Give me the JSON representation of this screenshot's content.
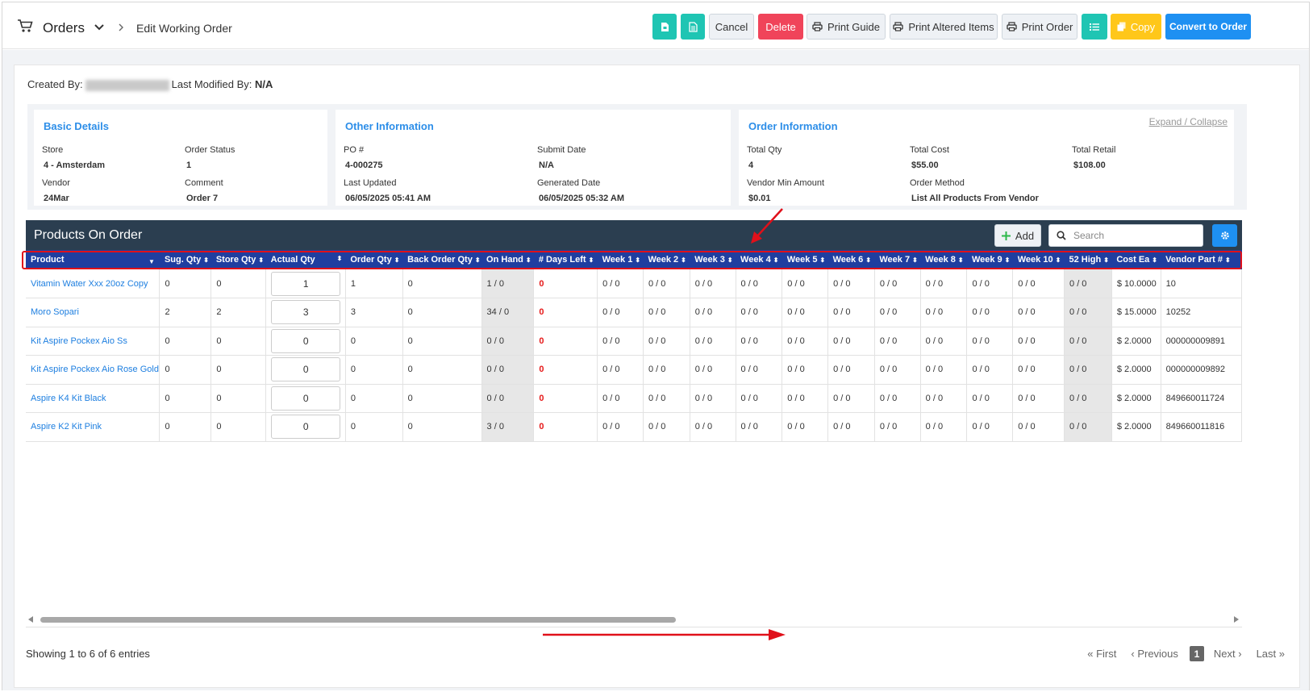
{
  "header": {
    "title": "Orders",
    "breadcrumb": "Edit Working Order",
    "buttons": {
      "cancel": "Cancel",
      "delete": "Delete",
      "print_guide": "Print Guide",
      "print_altered": "Print Altered Items",
      "print_order": "Print Order",
      "copy": "Copy",
      "convert": "Convert to Order"
    }
  },
  "meta": {
    "created_by_label": "Created By:",
    "last_modified_label": "Last Modified By:",
    "last_modified_value": "N/A"
  },
  "basic_details": {
    "title": "Basic Details",
    "store_label": "Store",
    "store_value": "4 - Amsterdam",
    "status_label": "Order Status",
    "status_value": "1",
    "vendor_label": "Vendor",
    "vendor_value": "24Mar",
    "comment_label": "Comment",
    "comment_value": "Order 7"
  },
  "other_info": {
    "title": "Other Information",
    "po_label": "PO #",
    "po_value": "4-000275",
    "submit_label": "Submit Date",
    "submit_value": "N/A",
    "updated_label": "Last Updated",
    "updated_value": "06/05/2025 05:41 AM",
    "generated_label": "Generated Date",
    "generated_value": "06/05/2025 05:32 AM"
  },
  "order_info": {
    "title": "Order Information",
    "expand_label": "Expand / Collapse",
    "qty_label": "Total Qty",
    "qty_value": "4",
    "cost_label": "Total Cost",
    "cost_value": "$55.00",
    "retail_label": "Total Retail",
    "retail_value": "$108.00",
    "min_label": "Vendor Min Amount",
    "min_value": "$0.01",
    "method_label": "Order Method",
    "method_value": "List All Products From Vendor"
  },
  "products": {
    "title": "Products On Order",
    "add_label": "Add",
    "search_placeholder": "Search",
    "columns": [
      "Product",
      "Sug. Qty",
      "Store Qty",
      "Actual Qty",
      "Order Qty",
      "Back Order Qty",
      "On Hand",
      "# Days Left",
      "Week 1",
      "Week 2",
      "Week 3",
      "Week 4",
      "Week 5",
      "Week 6",
      "Week 7",
      "Week 8",
      "Week 9",
      "Week 10",
      "52 High",
      "Cost Ea",
      "Vendor Part #"
    ],
    "rows": [
      {
        "product": "Vitamin Water Xxx 20oz Copy",
        "sug": "0",
        "store": "0",
        "actual": "1",
        "order": "1",
        "back": "0",
        "onhand": "1 / 0",
        "days": "0",
        "weeks": [
          "0 / 0",
          "0 / 0",
          "0 / 0",
          "0 / 0",
          "0 / 0",
          "0 / 0",
          "0 / 0",
          "0 / 0",
          "0 / 0",
          "0 / 0"
        ],
        "high": "0 / 0",
        "cost": "$ 10.0000",
        "part": "10"
      },
      {
        "product": "Moro Sopari",
        "sug": "2",
        "store": "2",
        "actual": "3",
        "order": "3",
        "back": "0",
        "onhand": "34 / 0",
        "days": "0",
        "weeks": [
          "0 / 0",
          "0 / 0",
          "0 / 0",
          "0 / 0",
          "0 / 0",
          "0 / 0",
          "0 / 0",
          "0 / 0",
          "0 / 0",
          "0 / 0"
        ],
        "high": "0 / 0",
        "cost": "$ 15.0000",
        "part": "10252"
      },
      {
        "product": "Kit Aspire Pockex Aio Ss",
        "sug": "0",
        "store": "0",
        "actual": "0",
        "order": "0",
        "back": "0",
        "onhand": "0 / 0",
        "days": "0",
        "weeks": [
          "0 / 0",
          "0 / 0",
          "0 / 0",
          "0 / 0",
          "0 / 0",
          "0 / 0",
          "0 / 0",
          "0 / 0",
          "0 / 0",
          "0 / 0"
        ],
        "high": "0 / 0",
        "cost": "$ 2.0000",
        "part": "000000009891"
      },
      {
        "product": "Kit Aspire Pockex Aio Rose Gold",
        "sug": "0",
        "store": "0",
        "actual": "0",
        "order": "0",
        "back": "0",
        "onhand": "0 / 0",
        "days": "0",
        "weeks": [
          "0 / 0",
          "0 / 0",
          "0 / 0",
          "0 / 0",
          "0 / 0",
          "0 / 0",
          "0 / 0",
          "0 / 0",
          "0 / 0",
          "0 / 0"
        ],
        "high": "0 / 0",
        "cost": "$ 2.0000",
        "part": "000000009892"
      },
      {
        "product": "Aspire K4 Kit Black",
        "sug": "0",
        "store": "0",
        "actual": "0",
        "order": "0",
        "back": "0",
        "onhand": "0 / 0",
        "days": "0",
        "weeks": [
          "0 / 0",
          "0 / 0",
          "0 / 0",
          "0 / 0",
          "0 / 0",
          "0 / 0",
          "0 / 0",
          "0 / 0",
          "0 / 0",
          "0 / 0"
        ],
        "high": "0 / 0",
        "cost": "$ 2.0000",
        "part": "849660011724"
      },
      {
        "product": "Aspire K2 Kit Pink",
        "sug": "0",
        "store": "0",
        "actual": "0",
        "order": "0",
        "back": "0",
        "onhand": "3 / 0",
        "days": "0",
        "weeks": [
          "0 / 0",
          "0 / 0",
          "0 / 0",
          "0 / 0",
          "0 / 0",
          "0 / 0",
          "0 / 0",
          "0 / 0",
          "0 / 0",
          "0 / 0"
        ],
        "high": "0 / 0",
        "cost": "$ 2.0000",
        "part": "849660011816"
      }
    ]
  },
  "footer": {
    "showing": "Showing 1 to 6 of 6 entries",
    "first": "« First",
    "previous": "‹ Previous",
    "current_page": "1",
    "next": "Next ›",
    "last": "Last »"
  },
  "colors": {
    "teal": "#1fc5b3",
    "red": "#f0445a",
    "yellow": "#ffc71a",
    "blue": "#1e90f2",
    "header_navy": "#2b3e50",
    "table_header": "#1f3ea0",
    "link": "#1e7fe0",
    "annotation": "#e0101a"
  }
}
